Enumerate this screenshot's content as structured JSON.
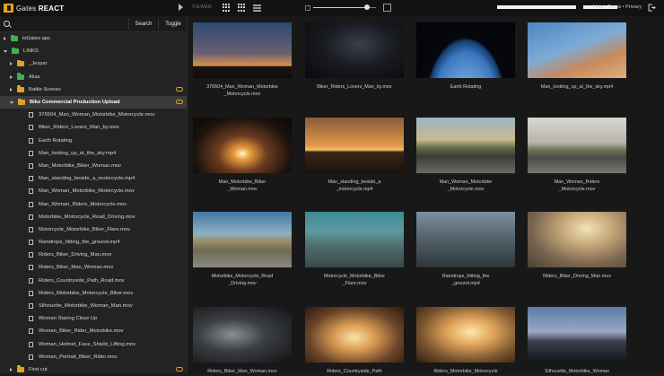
{
  "header": {
    "brand": "Gates",
    "product": "REACT",
    "viewer_label": "VIEWER",
    "help_links": "Help • Terms • Privacy"
  },
  "sidebar": {
    "search_label": "Search",
    "toggle_label": "Toggle",
    "tree": [
      {
        "label": "ioGates aps",
        "type": "folder-green",
        "indent": 0,
        "arrow": "right"
      },
      {
        "label": "LINKS",
        "type": "folder-green",
        "indent": 0,
        "arrow": "down"
      },
      {
        "label": "_Jesper",
        "type": "folder",
        "indent": 1,
        "arrow": "right"
      },
      {
        "label": "Alias",
        "type": "folder-green",
        "indent": 1,
        "arrow": "right"
      },
      {
        "label": "Battle Scenes",
        "type": "folder",
        "indent": 1,
        "arrow": "right",
        "link": true
      },
      {
        "label": "Bike Commercial Production Upload",
        "type": "folder",
        "indent": 1,
        "arrow": "down",
        "link": true,
        "selected": true
      },
      {
        "label": "376504_Man_Woman_Motorbike_Motorcycle.mov",
        "type": "file",
        "indent": 2
      },
      {
        "label": "Biker_Riders_Lovers_Man_by.mov",
        "type": "file",
        "indent": 2
      },
      {
        "label": "Earth Rotating",
        "type": "file",
        "indent": 2
      },
      {
        "label": "Man_looking_up_at_the_sky.mp4",
        "type": "file",
        "indent": 2
      },
      {
        "label": "Man_Motorbike_Biker_Woman.mov",
        "type": "file",
        "indent": 2
      },
      {
        "label": "Man_standing_beside_a_motorcycle.mp4",
        "type": "file",
        "indent": 2
      },
      {
        "label": "Man_Woman_Motorbike_Motorcycle.mov",
        "type": "file",
        "indent": 2
      },
      {
        "label": "Man_Woman_Riders_Motorcycle.mov",
        "type": "file",
        "indent": 2
      },
      {
        "label": "Motorbike_Motorcycle_Road_Driving.mov",
        "type": "file",
        "indent": 2
      },
      {
        "label": "Motorcycle_Motorbike_Biker_Flare.mov",
        "type": "file",
        "indent": 2
      },
      {
        "label": "Raindrops_hitting_the_ground.mp4",
        "type": "file",
        "indent": 2
      },
      {
        "label": "Riders_Biker_Driving_Man.mov",
        "type": "file",
        "indent": 2
      },
      {
        "label": "Riders_Biker_Man_Woman.mov",
        "type": "file",
        "indent": 2
      },
      {
        "label": "Riders_Countryside_Path_Road.mov",
        "type": "file",
        "indent": 2
      },
      {
        "label": "Riders_Motorbike_Motorcycle_Biker.mov",
        "type": "file",
        "indent": 2
      },
      {
        "label": "Silhouette_Motorbike_Woman_Man.mov",
        "type": "file",
        "indent": 2
      },
      {
        "label": "Woman Staring Close Up",
        "type": "file",
        "indent": 2
      },
      {
        "label": "Woman_Biker_Rider_Motorbike.mov",
        "type": "file",
        "indent": 2
      },
      {
        "label": "Woman_Helmet_Face_Shield_Lifting.mov",
        "type": "file",
        "indent": 2
      },
      {
        "label": "Woman_Portrait_Biker_Rider.mov",
        "type": "file",
        "indent": 2
      },
      {
        "label": "First cut",
        "type": "folder",
        "indent": 1,
        "arrow": "right",
        "link": true
      }
    ]
  },
  "thumbs": [
    {
      "caption": "376504_Man_Woman_Motorbike\n_Motorcycle.mov",
      "scene": "dusk"
    },
    {
      "caption": "Biker_Riders_Lovers_Man_by.mov",
      "scene": "night"
    },
    {
      "caption": "Earth Rotating",
      "scene": "earth"
    },
    {
      "caption": "Man_looking_up_at_the_sky.mp4",
      "scene": "sky"
    },
    {
      "caption": "Man_Motorbike_Biker\n_Woman.mov",
      "scene": "headlight"
    },
    {
      "caption": "Man_standing_beside_a\n_motorcycle.mp4",
      "scene": "sunset"
    },
    {
      "caption": "Man_Woman_Motorbike\n_Motorcycle.mov",
      "scene": "road"
    },
    {
      "caption": "Man_Woman_Riders\n_Motorcycle.mov",
      "scene": "road2"
    },
    {
      "caption": "Motorbike_Motorcycle_Road\n_Driving.mov",
      "scene": "field"
    },
    {
      "caption": "Motorcycle_Motorbike_Biker\n_Flare.mov",
      "scene": "teal"
    },
    {
      "caption": "Raindrops_hitting_the\n_ground.mp4",
      "scene": "rain"
    },
    {
      "caption": "Riders_Biker_Driving_Man.mov",
      "scene": "haze"
    },
    {
      "caption": "Riders_Biker_Man_Woman.mov",
      "scene": "chrome"
    },
    {
      "caption": "Riders_Countryside_Path",
      "scene": "warm"
    },
    {
      "caption": "Riders_Motorbike_Motorcycle",
      "scene": "gold"
    },
    {
      "caption": "Silhouette_Motorbike_Woman",
      "scene": "blue"
    }
  ],
  "colors": {
    "accent": "#e2a32a",
    "folder_green": "#3fb24e",
    "bg": "#181818"
  },
  "zoom": 0.85
}
